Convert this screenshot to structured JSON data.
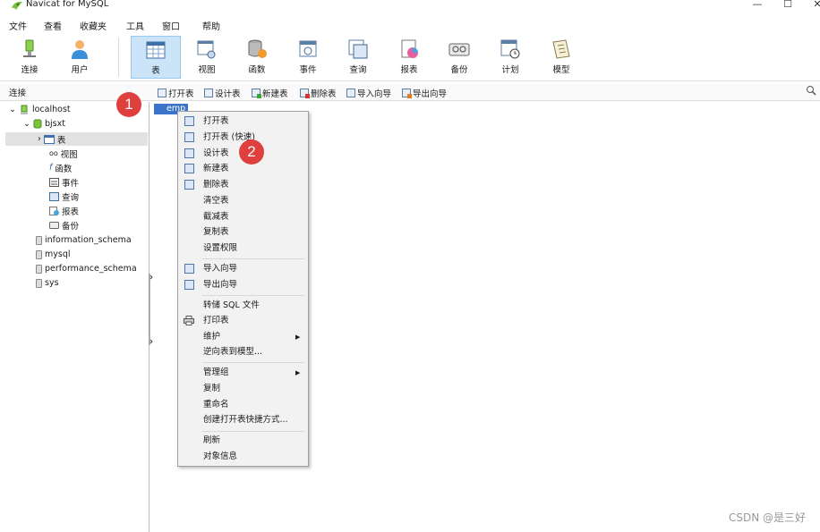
{
  "window": {
    "title": "Navicat for MySQL",
    "minimize_glyph": "—",
    "maximize_glyph": "☐",
    "close_glyph": "✕"
  },
  "menubar": {
    "items": [
      "文件",
      "查看",
      "收藏夹",
      "工具",
      "窗口",
      "帮助"
    ]
  },
  "toolbar": {
    "buttons": [
      {
        "label": "连接",
        "icon": "connection-icon"
      },
      {
        "label": "用户",
        "icon": "user-icon"
      },
      {
        "label": "表",
        "icon": "table-icon",
        "active": true
      },
      {
        "label": "视图",
        "icon": "view-icon"
      },
      {
        "label": "函数",
        "icon": "function-icon"
      },
      {
        "label": "事件",
        "icon": "event-icon"
      },
      {
        "label": "查询",
        "icon": "query-icon"
      },
      {
        "label": "报表",
        "icon": "report-icon"
      },
      {
        "label": "备份",
        "icon": "backup-icon"
      },
      {
        "label": "计划",
        "icon": "schedule-icon"
      },
      {
        "label": "模型",
        "icon": "model-icon"
      }
    ]
  },
  "objectbar": {
    "section_label": "连接",
    "buttons": [
      "打开表",
      "设计表",
      "新建表",
      "删除表",
      "导入向导",
      "导出向导"
    ]
  },
  "tree": {
    "connection": "localhost",
    "database": "bjsxt",
    "children": [
      "表",
      "视图",
      "函数",
      "事件",
      "查询",
      "报表",
      "备份"
    ],
    "other_databases": [
      "information_schema",
      "mysql",
      "performance_schema",
      "sys"
    ]
  },
  "tables": [
    "emp"
  ],
  "context_menu": {
    "items": [
      "打开表",
      "打开表 (快速)",
      "设计表",
      "新建表",
      "删除表",
      "清空表",
      "截减表",
      "复制表",
      "设置权限",
      "导入向导",
      "导出向导",
      "转储 SQL 文件",
      "打印表",
      "维护",
      "逆向表到模型...",
      "管理组",
      "复制",
      "重命名",
      "创建打开表快捷方式...",
      "刷新",
      "对象信息"
    ],
    "submenu_glyph": "▶"
  },
  "badges": [
    "1",
    "2"
  ],
  "watermark": "CSDN @是三好",
  "colors": {
    "selection": "#3c74c9",
    "active_toolbar": "#cce4f7",
    "badge": "#e0403d"
  }
}
